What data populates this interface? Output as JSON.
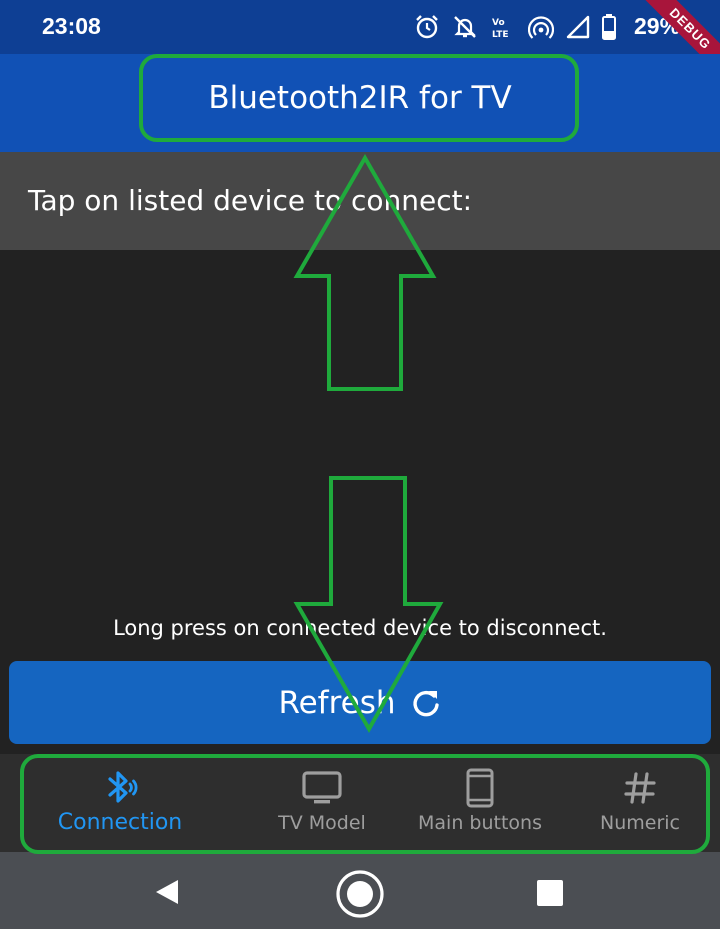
{
  "status_bar": {
    "time": "23:08",
    "battery_percent": "29%",
    "icons": [
      "alarm-icon",
      "notifications-off-icon",
      "volte-icon",
      "hotspot-icon",
      "signal-icon",
      "battery-icon"
    ],
    "debug_banner": "DEBUG"
  },
  "app_bar": {
    "title": "Bluetooth2IR for TV"
  },
  "device_list": {
    "header": "Tap on listed device to connect:",
    "items": []
  },
  "disconnect_hint": "Long press on connected device to disconnect.",
  "refresh_button": {
    "label": "Refresh",
    "icon": "refresh-icon"
  },
  "bottom_nav": {
    "selected": "Connection",
    "items": [
      {
        "label": "Connection",
        "icon": "bluetooth-audio-icon"
      },
      {
        "label": "TV Model",
        "icon": "tv-icon"
      },
      {
        "label": "Main buttons",
        "icon": "smartphone-icon"
      },
      {
        "label": "Numeric",
        "icon": "hash-icon"
      }
    ]
  },
  "system_nav": {
    "icons": [
      "back-icon",
      "home-icon",
      "recents-icon"
    ]
  },
  "colors": {
    "status_bar": "#0e3f94",
    "app_bar": "#1151b5",
    "header_background": "#474747",
    "body_background": "#222222",
    "button": "#1565c0",
    "nav_active": "#2196f3",
    "nav_inactive": "#9e9e9e",
    "annotation": "#1faa3c"
  }
}
